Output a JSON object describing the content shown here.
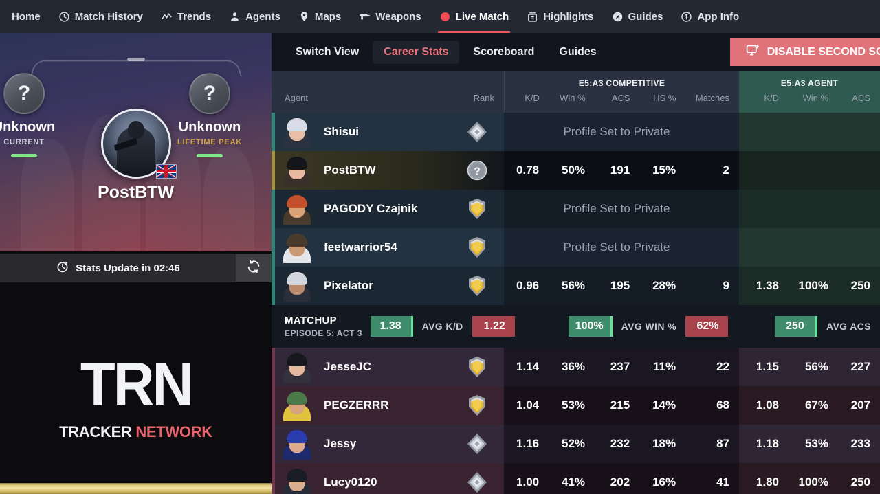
{
  "topnav": {
    "items": [
      {
        "label": "Home",
        "icon": "",
        "active": false
      },
      {
        "label": "Match History",
        "icon": "clock-icon",
        "active": false
      },
      {
        "label": "Trends",
        "icon": "trendline-icon",
        "active": false
      },
      {
        "label": "Agents",
        "icon": "person-icon",
        "active": false
      },
      {
        "label": "Maps",
        "icon": "pin-icon",
        "active": false
      },
      {
        "label": "Weapons",
        "icon": "gun-icon",
        "active": false
      },
      {
        "label": "Live Match",
        "icon": "live-dot-icon",
        "active": true
      },
      {
        "label": "Highlights",
        "icon": "film-icon",
        "active": false
      },
      {
        "label": "Guides",
        "icon": "compass-icon",
        "active": false
      },
      {
        "label": "App Info",
        "icon": "info-icon",
        "active": false
      }
    ]
  },
  "profile": {
    "current": {
      "rank": "Unknown",
      "label": "CURRENT",
      "badge": "?"
    },
    "peak": {
      "rank": "Unknown",
      "label": "LIFETIME PEAK",
      "badge": "?"
    },
    "player_name": "PostBTW",
    "country_flag": "uk-flag-icon",
    "update_text": "Stats Update in 02:46",
    "refresh_icon": "refresh-icon",
    "timer_icon": "timer-icon"
  },
  "branding": {
    "logo_main": "TRN",
    "logo_sub_white": "TRACKER ",
    "logo_sub_red": "NETWORK"
  },
  "subnav": {
    "tabs": [
      {
        "label": "Switch View",
        "active": false
      },
      {
        "label": "Career Stats",
        "active": true
      },
      {
        "label": "Scoreboard",
        "active": false
      },
      {
        "label": "Guides",
        "active": false
      }
    ],
    "disable_button": {
      "label": "DISABLE SECOND SCREEN",
      "icon": "monitor-icon"
    }
  },
  "table": {
    "groups": [
      {
        "title": "",
        "columns": [
          "Agent",
          "Rank"
        ]
      },
      {
        "title": "E5:A3 COMPETITIVE",
        "columns": [
          "K/D",
          "Win %",
          "ACS",
          "HS %",
          "Matches"
        ]
      },
      {
        "title": "E5:A3 AGENT",
        "columns": [
          "K/D",
          "Win %",
          "ACS"
        ]
      }
    ],
    "private_text": "Profile Set to Private",
    "rows": [
      {
        "name": "Shisui",
        "team": "ally",
        "alt": false,
        "private": true,
        "rank_icon": "rank-diamond-icon",
        "avatar": {
          "hair": "#d8dce6",
          "skin": "#e8c0a8",
          "body": "#2b3240"
        },
        "comp": {
          "kd": "",
          "win": "",
          "acs": "",
          "hs": "",
          "matches": ""
        },
        "agent": {
          "kd": "",
          "win": "",
          "acs": ""
        }
      },
      {
        "name": "PostBTW",
        "team": "me",
        "alt": false,
        "private": false,
        "rank_icon": "rank-unknown-icon",
        "avatar": {
          "hair": "#15161c",
          "skin": "#e8b99f",
          "body": "#3a2f2a"
        },
        "comp": {
          "kd": "0.78",
          "win": "50%",
          "acs": "191",
          "hs": "15%",
          "matches": "2"
        },
        "agent": {
          "kd": "",
          "win": "",
          "acs": ""
        }
      },
      {
        "name": "PAGODY Czajnik",
        "team": "ally",
        "alt": true,
        "private": true,
        "rank_icon": "rank-gold-icon",
        "avatar": {
          "hair": "#c2502a",
          "skin": "#d8a277",
          "body": "#4a3a2b"
        },
        "comp": {
          "kd": "",
          "win": "",
          "acs": "",
          "hs": "",
          "matches": ""
        },
        "agent": {
          "kd": "",
          "win": "",
          "acs": ""
        }
      },
      {
        "name": "feetwarrior54",
        "team": "ally",
        "alt": false,
        "private": true,
        "rank_icon": "rank-gold-icon",
        "avatar": {
          "hair": "#4a3a2c",
          "skin": "#c99a74",
          "body": "#e3e6ea"
        },
        "comp": {
          "kd": "",
          "win": "",
          "acs": "",
          "hs": "",
          "matches": ""
        },
        "agent": {
          "kd": "",
          "win": "",
          "acs": ""
        }
      },
      {
        "name": "Pixelator",
        "team": "ally",
        "alt": true,
        "private": false,
        "rank_icon": "rank-gold-icon",
        "avatar": {
          "hair": "#d3d6dc",
          "skin": "#b98a6b",
          "body": "#2a2e38"
        },
        "comp": {
          "kd": "0.96",
          "win": "56%",
          "acs": "195",
          "hs": "28%",
          "matches": "9"
        },
        "agent": {
          "kd": "1.38",
          "win": "100%",
          "acs": "250"
        }
      }
    ],
    "rows_enemy": [
      {
        "name": "JesseJC",
        "team": "enemy",
        "alt": false,
        "private": false,
        "rank_icon": "rank-gold-icon",
        "avatar": {
          "hair": "#17181e",
          "skin": "#e5b89e",
          "body": "#32323c"
        },
        "comp": {
          "kd": "1.14",
          "win": "36%",
          "acs": "237",
          "hs": "11%",
          "matches": "22"
        },
        "agent": {
          "kd": "1.15",
          "win": "56%",
          "acs": "227"
        }
      },
      {
        "name": "PEGZERRR",
        "team": "enemy",
        "alt": true,
        "private": false,
        "rank_icon": "rank-gold-icon",
        "avatar": {
          "hair": "#4a7a4a",
          "skin": "#d9a47d",
          "body": "#e0c23c"
        },
        "comp": {
          "kd": "1.04",
          "win": "53%",
          "acs": "215",
          "hs": "14%",
          "matches": "68"
        },
        "agent": {
          "kd": "1.08",
          "win": "67%",
          "acs": "207"
        }
      },
      {
        "name": "Jessy",
        "team": "enemy",
        "alt": false,
        "private": false,
        "rank_icon": "rank-diamond-icon",
        "avatar": {
          "hair": "#2b3bb0",
          "skin": "#dda98a",
          "body": "#1e2a6e"
        },
        "comp": {
          "kd": "1.16",
          "win": "52%",
          "acs": "232",
          "hs": "18%",
          "matches": "87"
        },
        "agent": {
          "kd": "1.18",
          "win": "53%",
          "acs": "233"
        }
      },
      {
        "name": "Lucy0120",
        "team": "enemy",
        "alt": true,
        "private": false,
        "rank_icon": "rank-diamond-icon",
        "avatar": {
          "hair": "#1b1d26",
          "skin": "#d9ae8e",
          "body": "#262b38"
        },
        "comp": {
          "kd": "1.00",
          "win": "41%",
          "acs": "202",
          "hs": "16%",
          "matches": "41"
        },
        "agent": {
          "kd": "1.80",
          "win": "100%",
          "acs": "250"
        }
      }
    ]
  },
  "matchup": {
    "title": "MATCHUP",
    "subtitle": "EPISODE 5: ACT 3",
    "stats": [
      {
        "label": "AVG K/D",
        "ally": "1.38",
        "enemy": "1.22"
      },
      {
        "label": "AVG WIN %",
        "ally": "100%",
        "enemy": "62%"
      },
      {
        "label": "AVG ACS",
        "ally": "250",
        "enemy": ""
      }
    ]
  },
  "colors": {
    "accent_red": "#f05b62",
    "ally_teal": "#2e8577",
    "enemy_maroon": "#6f3a4d",
    "chip_green": "#3e8c6c",
    "chip_red": "#a8434c",
    "gold": "#d9c66e"
  }
}
